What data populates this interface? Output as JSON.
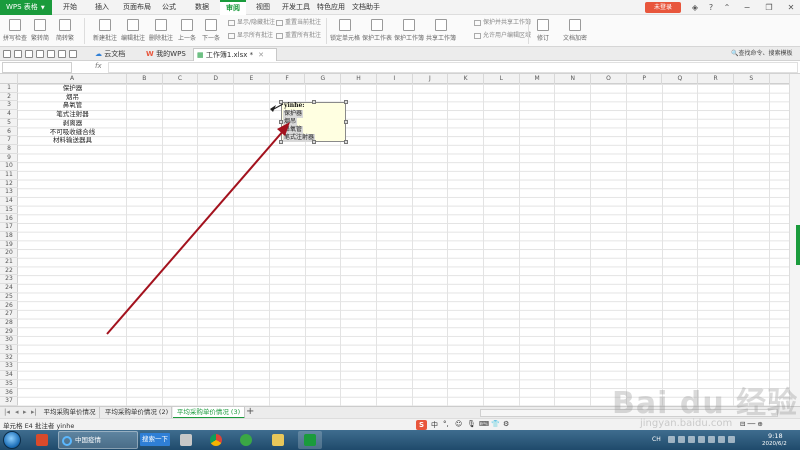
{
  "app": {
    "menu_label": "WPS 表格",
    "tabs": [
      "开始",
      "插入",
      "页面布局",
      "公式",
      "数据",
      "审阅",
      "视图",
      "开发工具",
      "特色应用",
      "文档助手"
    ],
    "active_tab": "审阅",
    "login_label": "未登录"
  },
  "ribbon": {
    "large_buttons": [
      "拼写检查",
      "繁转简",
      "简转繁",
      "新建批注",
      "编辑批注",
      "删除批注",
      "上一条",
      "下一条",
      "锁定单元格",
      "保护工作表",
      "保护工作簿",
      "共享工作簿",
      "修订",
      "文档加密"
    ],
    "small_buttons": [
      "显示/隐藏批注",
      "显示所有批注",
      "重置当前批注",
      "重置所有批注",
      "保护并共享工作簿",
      "允许用户编辑区域"
    ]
  },
  "docbar": {
    "tabs": [
      {
        "label": "云文档"
      },
      {
        "label": "我的WPS"
      },
      {
        "label": "工作簿1.xlsx *"
      }
    ],
    "search_label": "查找命令、搜索模板"
  },
  "formula_bar": {
    "fx_label": "fx",
    "name_box": "",
    "formula": ""
  },
  "columns": [
    "A",
    "B",
    "C",
    "D",
    "E",
    "F",
    "G",
    "H",
    "I",
    "J",
    "K",
    "L",
    "M",
    "N",
    "O",
    "P",
    "Q",
    "R",
    "S"
  ],
  "rows_count": 37,
  "cells_col_a": [
    "保护器",
    "烟吊",
    "鼻氧管",
    "笔式注射器",
    "剥离器",
    "不可吸收缝合线",
    "材料输送器具"
  ],
  "comment": {
    "author": "yinhe:",
    "lines": [
      "保护器",
      "烟吊",
      "鼻氧管",
      "笔式注射器"
    ]
  },
  "sheets": {
    "tabs": [
      "平均采购单价情况",
      "平均采购单价情况 (2)",
      "平均采购单价情况 (3)"
    ],
    "active_index": 2,
    "add_label": "+"
  },
  "status": {
    "text": "单元格 E4 批注者 yinhe",
    "ime_items": [
      "中",
      "°,",
      "☺",
      "🎙",
      "⌨",
      "👕",
      "⚙"
    ]
  },
  "taskbar": {
    "ie_label": "中国疫情",
    "search_button": "搜索一下",
    "clock_time": "9:18",
    "clock_date": "2020/6/2",
    "tray_label": "CH"
  },
  "watermark": {
    "main": "Bai du 经验",
    "sub": "jingyan.baidu.com"
  },
  "colors": {
    "accent": "#1a9b3c",
    "login": "#e8563c",
    "arrow": "#a3121e",
    "comment_bg": "#ffffe1"
  }
}
